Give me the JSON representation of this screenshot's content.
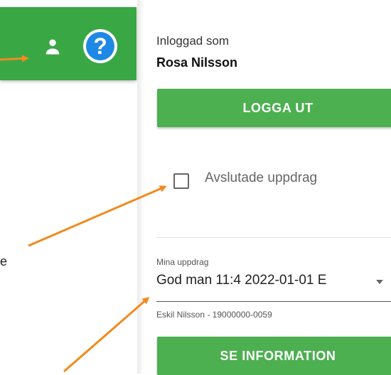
{
  "header": {
    "person_icon": "person-icon",
    "help_icon": "help-circle-icon",
    "help_glyph": "?"
  },
  "left_fragment": {
    "text": "e"
  },
  "account": {
    "logged_in_label": "Inloggad som",
    "user_name": "Rosa Nilsson",
    "logout_label": "LOGGA UT"
  },
  "filter": {
    "completed_label": "Avslutade uppdrag",
    "checked": false
  },
  "assignments": {
    "label": "Mina uppdrag",
    "selected": "God man 11:4 2022-01-01 E",
    "helper": "Eskil Nilsson - 19000000-0059",
    "info_button_label": "SE INFORMATION"
  },
  "colors": {
    "header_green": "#3aa745",
    "button_green": "#4caf50",
    "help_blue": "#1e88e5",
    "annotation_orange": "#f28a1e"
  }
}
